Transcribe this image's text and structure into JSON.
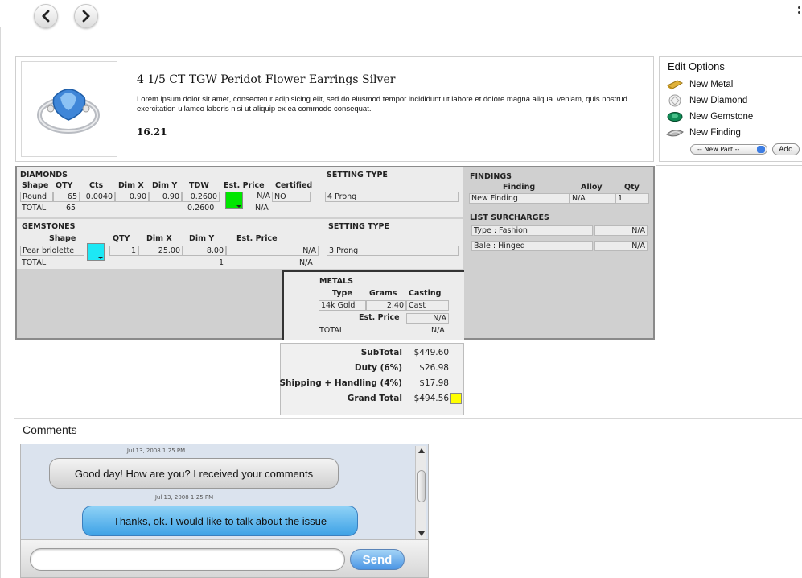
{
  "nav": {
    "back_icon": "chevron-left-icon",
    "forward_icon": "chevron-right-icon"
  },
  "product": {
    "title": "4 1/5 CT TGW Peridot Flower Earrings Silver",
    "description": "Lorem ipsum dolor sit amet, consectetur adipisicing elit, sed do eiusmod tempor incididunt ut labore et dolore magna aliqua. veniam, quis nostrud exercitation ullamco laboris nisi ut aliquip ex ea commodo consequat.",
    "price": "16.21"
  },
  "edit_options": {
    "title": "Edit Options",
    "items": [
      {
        "label": "New Metal",
        "icon": "metal-bar-icon"
      },
      {
        "label": "New Diamond",
        "icon": "diamond-icon"
      },
      {
        "label": "New Gemstone",
        "icon": "gemstone-icon"
      },
      {
        "label": "New Finding",
        "icon": "finding-icon"
      }
    ],
    "select_value": "-- New Part --",
    "add_label": "Add"
  },
  "diamonds": {
    "title": "DIAMONDS",
    "headers": [
      "Shape",
      "QTY",
      "Cts",
      "Dim X",
      "Dim Y",
      "TDW",
      "Est. Price",
      "Certified"
    ],
    "row": {
      "shape": "Round",
      "qty": "65",
      "cts": "0.0040",
      "dimx": "0.90",
      "dimy": "0.90",
      "tdw": "0.2600",
      "price": "N/A",
      "certified": "NO",
      "color": "#00e600"
    },
    "total": {
      "label": "TOTAL",
      "qty": "65",
      "tdw": "0.2600",
      "price": "N/A"
    },
    "setting_title": "SETTING TYPE",
    "setting_value": "4 Prong"
  },
  "gemstones": {
    "title": "GEMSTONES",
    "headers": [
      "Shape",
      "QTY",
      "Dim X",
      "Dim Y",
      "Est. Price"
    ],
    "row": {
      "shape": "Pear briolette",
      "qty": "1",
      "dimx": "25.00",
      "dimy": "8.00",
      "price": "N/A",
      "color": "#1de8f5"
    },
    "total": {
      "label": "TOTAL",
      "qty": "1",
      "price": "N/A"
    },
    "setting_title": "SETTING TYPE",
    "setting_value": "3 Prong"
  },
  "metals": {
    "title": "METALS",
    "headers": [
      "Type",
      "Grams",
      "Casting"
    ],
    "row": {
      "type": "14k Gold",
      "grams": "2.40",
      "casting": "Cast"
    },
    "est_price_label": "Est. Price",
    "est_price": "N/A",
    "total": {
      "label": "TOTAL",
      "price": "N/A"
    }
  },
  "findings": {
    "title": "FINDINGS",
    "headers": [
      "Finding",
      "Alloy",
      "Qty"
    ],
    "row": {
      "finding": "New Finding",
      "alloy": "N/A",
      "qty": "1"
    }
  },
  "surcharges": {
    "title": "LIST SURCHARGES",
    "rows": [
      {
        "label": "Type : Fashion",
        "value": "N/A"
      },
      {
        "label": "Bale : Hinged",
        "value": "N/A"
      }
    ]
  },
  "totals": {
    "rows": [
      {
        "label": "SubTotal",
        "value": "$449.60"
      },
      {
        "label": "Duty (6%)",
        "value": "$26.98"
      },
      {
        "label": "Shipping + Handling (4%)",
        "value": "$17.98"
      },
      {
        "label": "Grand Total",
        "value": "$494.56"
      }
    ],
    "grand_color": "#ffff00"
  },
  "comments": {
    "title": "Comments",
    "messages": [
      {
        "timestamp": "Jul 13, 2008 1:25 PM",
        "text": "Good day! How are you? I received your comments"
      },
      {
        "timestamp": "Jul 13, 2008 1:25 PM",
        "text": "Thanks, ok.  I would like to talk about the issue"
      }
    ],
    "input_value": "",
    "send_label": "Send"
  }
}
